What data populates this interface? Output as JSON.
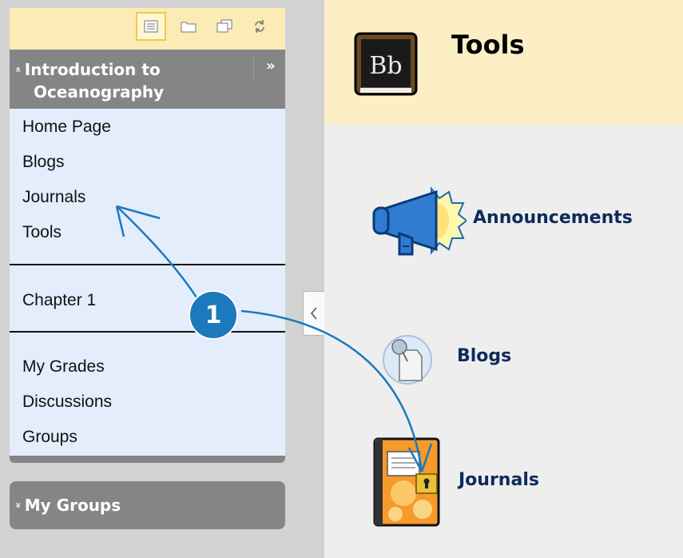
{
  "toolbar": {
    "buttons": [
      {
        "name": "list-view-icon",
        "selected": true
      },
      {
        "name": "folder-view-icon",
        "selected": false
      },
      {
        "name": "new-window-icon",
        "selected": false
      },
      {
        "name": "refresh-icon",
        "selected": false
      }
    ]
  },
  "course_menu": {
    "title_line1": "Introduction to",
    "title_line2": "Oceanography",
    "collapse_glyph": "«",
    "expand_glyph": "»",
    "section1": [
      "Home Page",
      "Blogs",
      "Journals",
      "Tools"
    ],
    "section2": [
      "Chapter 1"
    ],
    "section3": [
      "My Grades",
      "Discussions",
      "Groups"
    ]
  },
  "my_groups": {
    "label": "My Groups",
    "glyph": "»"
  },
  "collapse_tab": {
    "glyph": "<"
  },
  "header": {
    "logo_text": "Bb",
    "title": "Tools"
  },
  "tools": {
    "announcements": "Announcements",
    "blogs": "Blogs",
    "journals": "Journals"
  },
  "callout": {
    "badge": "1",
    "color": "#1c79bd"
  },
  "colors": {
    "menu_header": "#858585",
    "menu_body": "#e3edfb",
    "toolbar_bg": "#fbebb4",
    "page_header_bg": "#fcefc6",
    "content_bg": "#eeeeee",
    "link_text": "#0e2a5c"
  }
}
